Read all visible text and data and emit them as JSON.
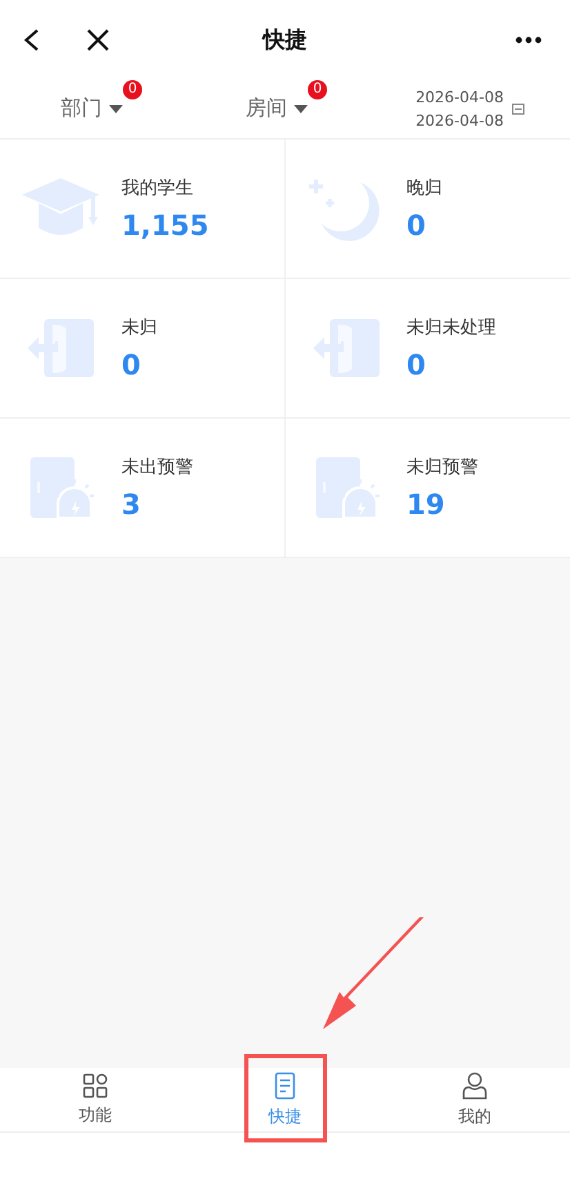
{
  "header": {
    "title": "快捷"
  },
  "filters": [
    {
      "label": "部门",
      "badge": "0"
    },
    {
      "label": "房间",
      "badge": "0"
    }
  ],
  "date_range": {
    "start": "2026-04-08",
    "end": "2026-04-08"
  },
  "tiles": [
    {
      "kind": "cap",
      "label": "我的学生",
      "value": "1,155"
    },
    {
      "kind": "moon",
      "label": "晚归",
      "value": "0"
    },
    {
      "kind": "door-exit",
      "label": "未归",
      "value": "0"
    },
    {
      "kind": "door-exit",
      "label": "未归未处理",
      "value": "0"
    },
    {
      "kind": "door-alarm",
      "label": "未出预警",
      "value": "3"
    },
    {
      "kind": "door-alarm",
      "label": "未归预警",
      "value": "19"
    }
  ],
  "tab_bar": [
    {
      "kind": "grid",
      "label": "功能",
      "selected": false,
      "highlighted": false
    },
    {
      "kind": "doc",
      "label": "快捷",
      "selected": true,
      "highlighted": true
    },
    {
      "kind": "person",
      "label": "我的",
      "selected": false,
      "highlighted": false
    }
  ]
}
